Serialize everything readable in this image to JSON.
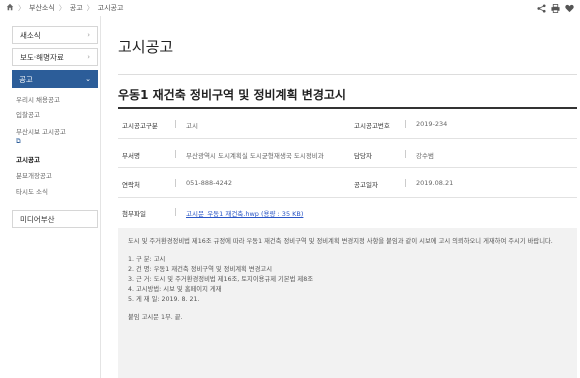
{
  "breadcrumb": {
    "items": [
      "부산소식",
      "공고",
      "고시공고"
    ]
  },
  "top_icons": [
    "share-icon",
    "print-icon",
    "heart-icon"
  ],
  "sidebar": {
    "boxes": [
      "새소식",
      "보도·해명자료"
    ],
    "active": "공고",
    "sub_items": [
      "우리시 채용공고",
      "입찰공고",
      "부산시보 고시공고",
      "고시공고",
      "분묘개장공고",
      "타시도 소식"
    ],
    "current_sub": "고시공고",
    "bottom_box": "미디어부산"
  },
  "page": {
    "title": "고시공고",
    "doc_title": "우동1 재건축 정비구역 및 정비계획 변경고시"
  },
  "info": {
    "gubun_label": "고시공고구분",
    "gubun_value": "고시",
    "number_label": "고시공고번호",
    "number_value": "2019-234",
    "dept_label": "부서명",
    "dept_value": "부산광역시 도시계획실 도시균형재생국 도시정비과",
    "manager_label": "담당자",
    "manager_value": "강수범",
    "contact_label": "연락처",
    "contact_value": "051-888-4242",
    "date_label": "공고일자",
    "date_value": "2019.08.21",
    "file_label": "첨부파일",
    "file_value": "고시문_우동1 재건축.hwp (용량 : 35 KB)"
  },
  "content": {
    "intro": "도시 및 주거환경정비법 제16조 규정에 따라 우동1 재건축 정비구역 및 정비계획 변경지정 사항을 붙임과 같이 시보에 고시 의뢰하오니 게재하여 주시기 바랍니다.",
    "lines": [
      "1. 구 분: 고시",
      "2. 건 명: 우동1 재건축 정비구역 및 정비계획 변경고시",
      "3. 근 거: 도시 및 주거환경정비법 제16조, 토지이용규제 기본법 제8조",
      "4. 고시방법: 시보 및 홈페이지 게재",
      "5. 게 재 일: 2019. 8. 21."
    ],
    "attachment_note": "붙임 고시문 1부. 끝."
  }
}
